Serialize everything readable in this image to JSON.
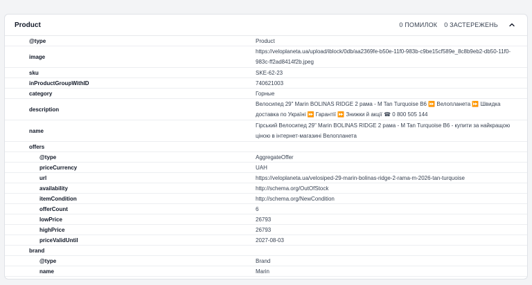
{
  "card": {
    "title": "Product",
    "errors": "0 ПОМИЛОК",
    "warnings": "0 ЗАСТЕРЕЖЕНЬ"
  },
  "rows": [
    {
      "key": "@type",
      "value": "Product"
    },
    {
      "key": "image",
      "value": "https://veloplaneta.ua/upload/iblock/0db/aa2369fe-b50e-11f0-983b-c9be15cf589e_8c8b9eb2-db50-11f0-983c-ff2ad8414f2b.jpeg"
    },
    {
      "key": "sku",
      "value": "SKE-62-23"
    },
    {
      "key": "inProductGroupWithID",
      "value": "740621003"
    },
    {
      "key": "category",
      "value": "Горные"
    },
    {
      "key": "description",
      "value": "Велосипед 29\" Marin BOLINAS RIDGE 2 рама - M Tan Turquoise B6 ⏩ Велопланета ⏩ Швидка доставка по Україні ⏩ Гарантії ⏩ Знижки й акції ☎ 0 800 505 144"
    },
    {
      "key": "name",
      "value": "Гірський Велосипед 29\" Marin BOLINAS RIDGE 2 рама - M Tan Turquoise B6 - купити за найкращою ціною в інтернет-магазині Велопланета"
    },
    {
      "key": "offers",
      "value": ""
    },
    {
      "key": "@type",
      "value": "AggregateOffer"
    },
    {
      "key": "priceCurrency",
      "value": "UAH"
    },
    {
      "key": "url",
      "value": "https://veloplaneta.ua/velosiped-29-marin-bolinas-ridge-2-rama-m-2026-tan-turquoise"
    },
    {
      "key": "availability",
      "value": "http://schema.org/OutOfStock"
    },
    {
      "key": "itemCondition",
      "value": "http://schema.org/NewCondition"
    },
    {
      "key": "offerCount",
      "value": "6"
    },
    {
      "key": "lowPrice",
      "value": "26793"
    },
    {
      "key": "highPrice",
      "value": "26793"
    },
    {
      "key": "priceValidUntil",
      "value": "2027-08-03"
    },
    {
      "key": "brand",
      "value": ""
    },
    {
      "key": "@type",
      "value": "Brand"
    },
    {
      "key": "name",
      "value": "Marin"
    }
  ],
  "icons": {
    "toggle": "chevron-up-icon"
  },
  "colors": {
    "badge": "#3b82f6"
  }
}
